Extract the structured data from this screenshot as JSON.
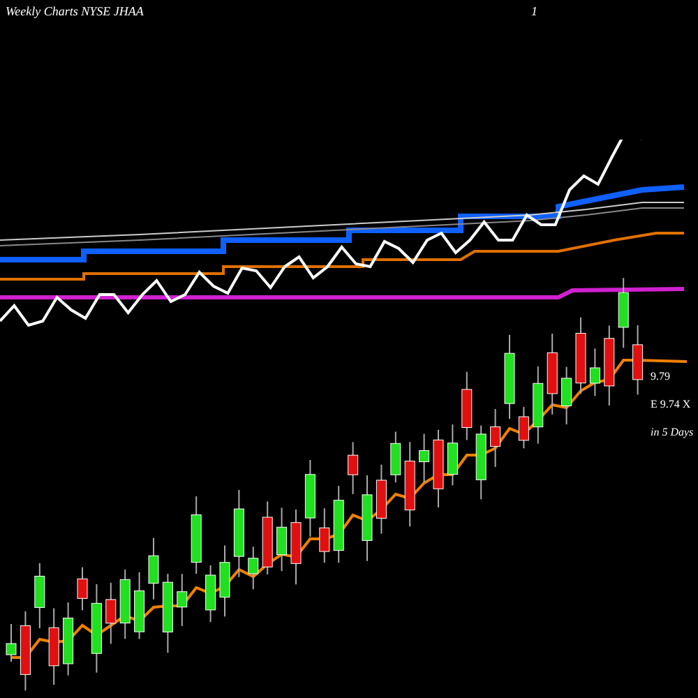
{
  "header": {
    "title": "Weekly Charts NYSE JHAA",
    "marker": "1"
  },
  "labels": [
    {
      "text": "9.79"
    },
    {
      "text": "E 9.74 X"
    },
    {
      "text": "in 5 Days"
    }
  ]
}
